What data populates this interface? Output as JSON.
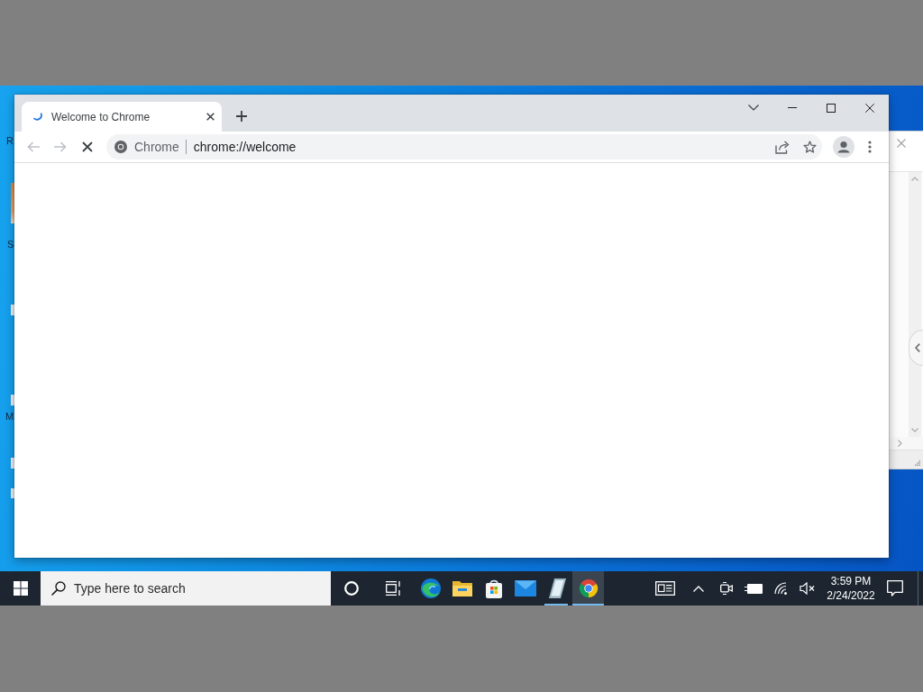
{
  "desktop": {
    "icon_labels": [
      "R",
      "S",
      "M"
    ]
  },
  "browser": {
    "tabs": [
      {
        "title": "Welcome to Chrome",
        "selected": true
      }
    ],
    "loading": true,
    "toolbar": {
      "back_disabled": true,
      "forward_disabled": true
    },
    "omnibox": {
      "site_label": "Chrome",
      "url": "chrome://welcome"
    }
  },
  "taskbar": {
    "search": {
      "placeholder": "Type here to search"
    },
    "apps": [
      {
        "kind": "edge",
        "running": false,
        "selected": false
      },
      {
        "kind": "explorer",
        "running": false,
        "selected": false
      },
      {
        "kind": "store",
        "running": false,
        "selected": false
      },
      {
        "kind": "mail",
        "running": false,
        "selected": false
      },
      {
        "kind": "notes",
        "running": true,
        "selected": false
      },
      {
        "kind": "chrome",
        "running": true,
        "selected": true
      }
    ],
    "tray": {
      "volume_muted": true
    },
    "clock": {
      "time": "3:59 PM",
      "date": "2/24/2022"
    }
  }
}
